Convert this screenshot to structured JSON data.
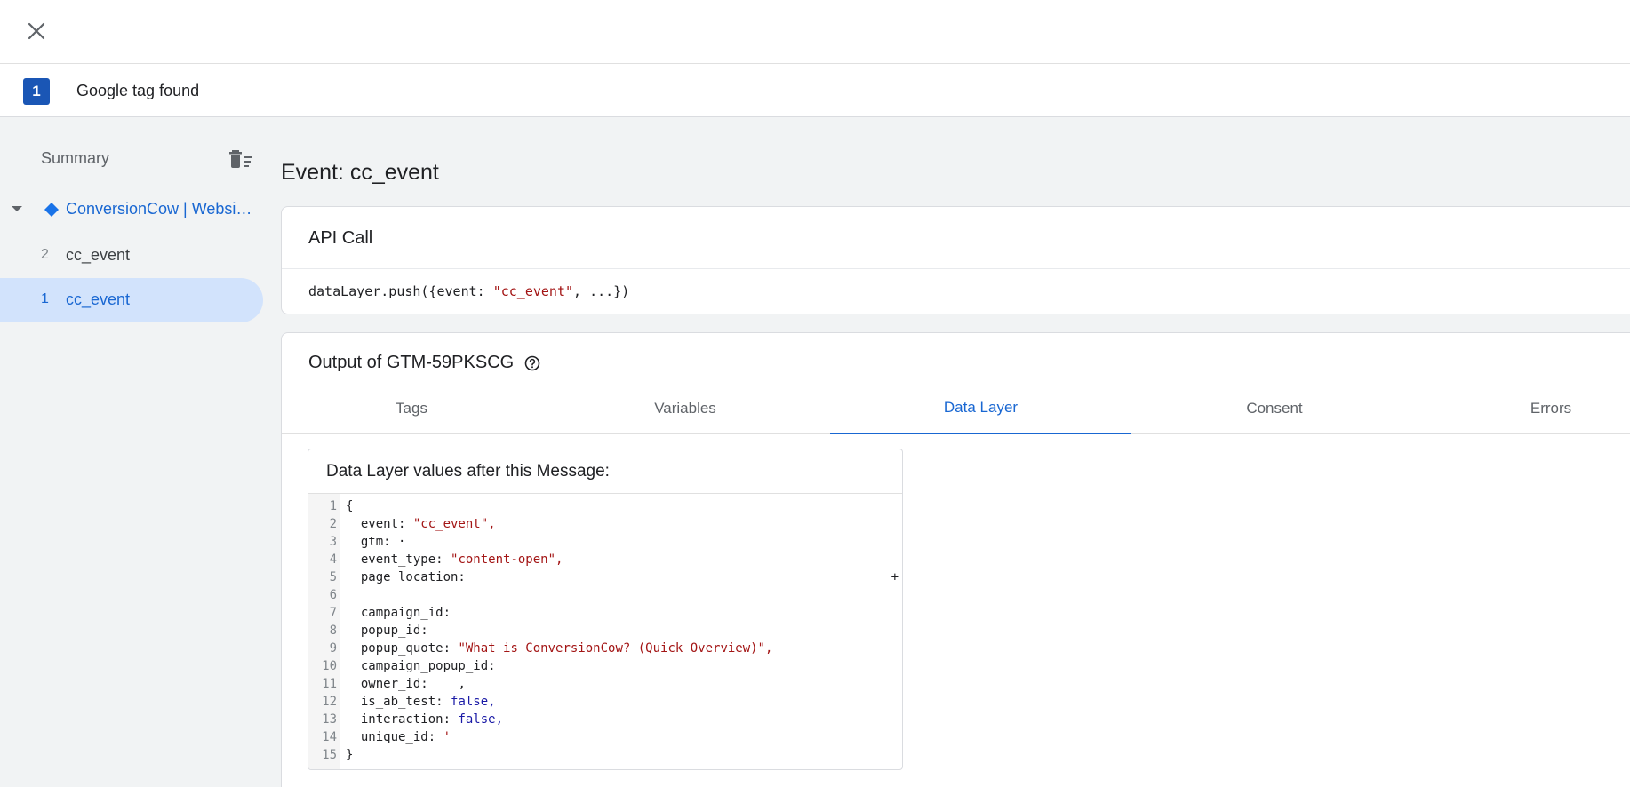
{
  "tag_bar": {
    "count": "1",
    "label": "Google tag found"
  },
  "sidebar": {
    "summary_label": "Summary",
    "container_name": "ConversionCow | Websi…",
    "events": [
      {
        "number": "2",
        "label": "cc_event"
      },
      {
        "number": "1",
        "label": "cc_event"
      }
    ]
  },
  "main": {
    "title": "Event: cc_event",
    "api_card": {
      "title": "API Call",
      "code_prefix": "dataLayer.push({event: ",
      "code_event": "\"cc_event\"",
      "code_suffix": ", ...})"
    },
    "output_card": {
      "title": "Output of GTM-59PKSCG",
      "tabs": [
        "Tags",
        "Variables",
        "Data Layer",
        "Consent",
        "Errors"
      ],
      "active_tab": "Data Layer"
    },
    "data_layer": {
      "header": "Data Layer values after this Message:",
      "expand_symbol": "+",
      "lines": [
        {
          "n": "1",
          "key": "{",
          "val": "",
          "t": ""
        },
        {
          "n": "2",
          "key": "  event: ",
          "val": "\"cc_event\",",
          "t": "str"
        },
        {
          "n": "3",
          "key": "  gtm: ",
          "val": "·",
          "t": ""
        },
        {
          "n": "4",
          "key": "  event_type: ",
          "val": "\"content-open\",",
          "t": "str"
        },
        {
          "n": "5",
          "key": "  page_location: ",
          "val": "",
          "t": ""
        },
        {
          "n": "6",
          "key": "",
          "val": "",
          "t": ""
        },
        {
          "n": "7",
          "key": "  campaign_id: ",
          "val": "",
          "t": ""
        },
        {
          "n": "8",
          "key": "  popup_id: ",
          "val": "",
          "t": ""
        },
        {
          "n": "9",
          "key": "  popup_quote: ",
          "val": "\"What is ConversionCow? (Quick Overview)\",",
          "t": "str"
        },
        {
          "n": "10",
          "key": "  campaign_popup_id: ",
          "val": "",
          "t": ""
        },
        {
          "n": "11",
          "key": "  owner_id: ",
          "val": "   ,",
          "t": ""
        },
        {
          "n": "12",
          "key": "  is_ab_test: ",
          "val": "false,",
          "t": "kw"
        },
        {
          "n": "13",
          "key": "  interaction: ",
          "val": "false,",
          "t": "kw"
        },
        {
          "n": "14",
          "key": "  unique_id: ",
          "val": "'",
          "t": "str"
        },
        {
          "n": "15",
          "key": "}",
          "val": "",
          "t": ""
        }
      ]
    }
  }
}
